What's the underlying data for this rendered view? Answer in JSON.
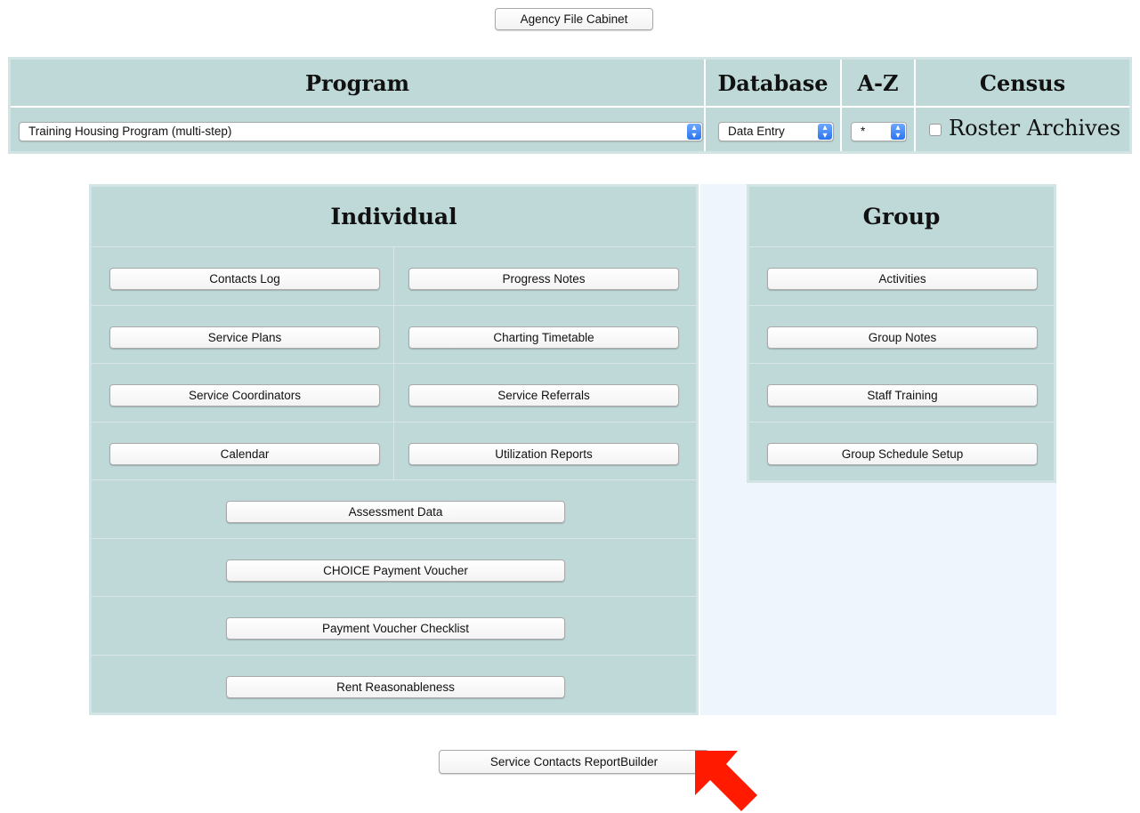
{
  "top_button": "Agency File Cabinet",
  "headers": {
    "program": "Program",
    "database": "Database",
    "az": "A-Z",
    "census": "Census"
  },
  "program_select": {
    "value": "Training Housing Program (multi-step)"
  },
  "database_select": {
    "value": "Data Entry"
  },
  "az_select": {
    "value": "*"
  },
  "roster_archives": {
    "label": "Roster Archives",
    "checked": false
  },
  "individual": {
    "title": "Individual",
    "buttons": [
      "Contacts Log",
      "Progress Notes",
      "Service Plans",
      "Charting Timetable",
      "Service Coordinators",
      "Service Referrals",
      "Calendar",
      "Utilization Reports",
      "Assessment Data",
      "CHOICE Payment Voucher",
      "Payment Voucher Checklist",
      "Rent Reasonableness"
    ]
  },
  "group": {
    "title": "Group",
    "buttons": [
      "Activities",
      "Group Notes",
      "Staff Training",
      "Group Schedule Setup"
    ]
  },
  "bottom_button": "Service Contacts ReportBuilder",
  "colors": {
    "cell_bg": "#bfd9d8",
    "border": "#d3e4e4",
    "gap_bg": "#eef5fc",
    "arrow": "#ff1a00",
    "select_accent": "#2a74ef"
  }
}
